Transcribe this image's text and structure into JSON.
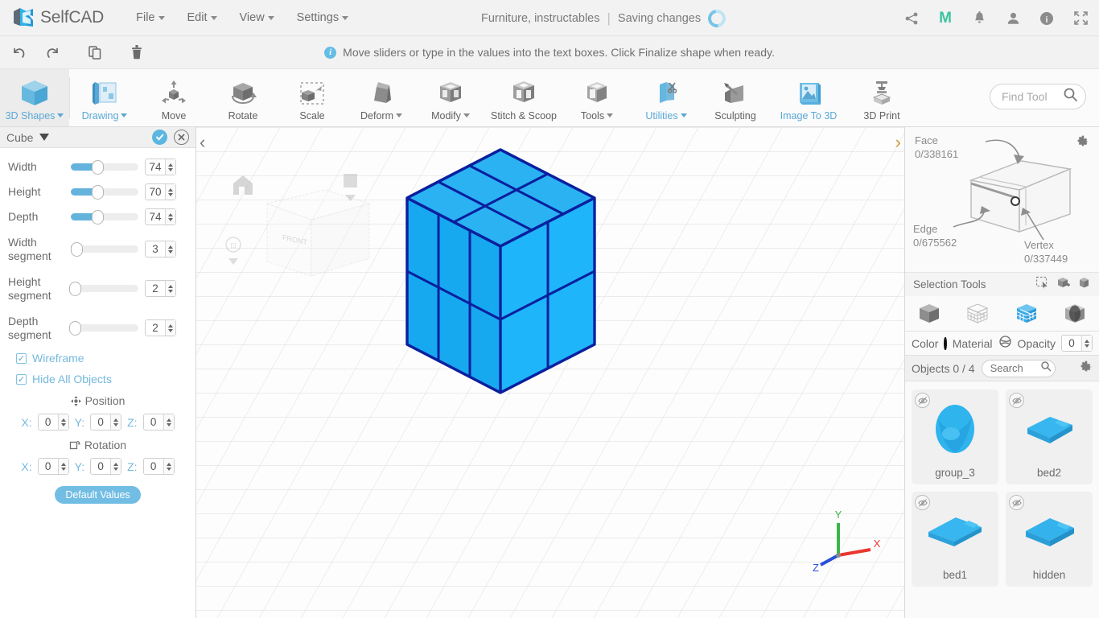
{
  "app": {
    "brand": "SelfCAD",
    "menus": [
      {
        "label": "File",
        "caret": true
      },
      {
        "label": "Edit",
        "caret": true
      },
      {
        "label": "View",
        "caret": true
      },
      {
        "label": "Settings",
        "caret": true
      }
    ],
    "document_title": "Furniture, instructables",
    "separator": "|",
    "save_status": "Saving changes",
    "top_icons": [
      {
        "name": "share-icon"
      },
      {
        "name": "m-brand-icon",
        "label": "M",
        "color": "#3ec3a0"
      },
      {
        "name": "notifications-bell-icon"
      },
      {
        "name": "user-account-icon"
      },
      {
        "name": "info-icon"
      },
      {
        "name": "fullscreen-icon"
      }
    ]
  },
  "strip": {
    "buttons": [
      {
        "name": "undo-button"
      },
      {
        "name": "redo-button"
      },
      {
        "name": "copy-button"
      },
      {
        "name": "delete-button"
      }
    ],
    "message": "Move sliders or type in the values into the text boxes. Click Finalize shape when ready."
  },
  "ribbon": {
    "items": [
      {
        "label": "3D Shapes",
        "caret": true,
        "blue": true,
        "active": true,
        "icon": "cube-icon"
      },
      {
        "label": "Drawing",
        "caret": true,
        "blue": true,
        "icon": "drawing-icon"
      },
      {
        "label": "Move",
        "caret": false,
        "blue": false,
        "icon": "move-icon"
      },
      {
        "label": "Rotate",
        "caret": false,
        "blue": false,
        "icon": "rotate-icon"
      },
      {
        "label": "Scale",
        "caret": false,
        "blue": false,
        "icon": "scale-icon"
      },
      {
        "label": "Deform",
        "caret": true,
        "blue": false,
        "icon": "deform-icon"
      },
      {
        "label": "Modify",
        "caret": true,
        "blue": false,
        "icon": "modify-icon"
      },
      {
        "label": "Stitch & Scoop",
        "caret": false,
        "blue": false,
        "icon": "stitch-scoop-icon"
      },
      {
        "label": "Tools",
        "caret": true,
        "blue": false,
        "icon": "tools-icon"
      },
      {
        "label": "Utilities",
        "caret": true,
        "blue": true,
        "icon": "utilities-icon"
      },
      {
        "label": "Sculpting",
        "caret": false,
        "blue": false,
        "icon": "sculpting-icon"
      },
      {
        "label": "Image To 3D",
        "caret": false,
        "blue": true,
        "icon": "image-to-3d-icon"
      },
      {
        "label": "3D Print",
        "caret": false,
        "blue": false,
        "icon": "3d-print-icon"
      }
    ],
    "find_tool_placeholder": "Find Tool",
    "find_tool_value": ""
  },
  "left_panel": {
    "title": "Cube",
    "confirm_label": "✓",
    "cancel_label": "✕",
    "sliders": [
      {
        "label": "Width",
        "value": "74",
        "fill_pct": 37
      },
      {
        "label": "Height",
        "value": "70",
        "fill_pct": 37
      },
      {
        "label": "Depth",
        "value": "74",
        "fill_pct": 37
      },
      {
        "label": "Width segment",
        "value": "3",
        "fill_pct": 3
      },
      {
        "label": "Height segment",
        "value": "2",
        "fill_pct": 0
      },
      {
        "label": "Depth segment",
        "value": "2",
        "fill_pct": 0
      }
    ],
    "checkboxes": [
      {
        "label": "Wireframe",
        "checked": true
      },
      {
        "label": "Hide All Objects",
        "checked": true
      }
    ],
    "position": {
      "heading": "Position",
      "axes": [
        {
          "label": "X:",
          "value": "0"
        },
        {
          "label": "Y:",
          "value": "0"
        },
        {
          "label": "Z:",
          "value": "0"
        }
      ]
    },
    "rotation": {
      "heading": "Rotation",
      "axes": [
        {
          "label": "X:",
          "value": "0"
        },
        {
          "label": "Y:",
          "value": "0"
        },
        {
          "label": "Z:",
          "value": "0"
        }
      ]
    },
    "default_values_label": "Default Values"
  },
  "viewport": {
    "collapse_left_label": "‹",
    "collapse_right_label": "›",
    "navcube_face_label": "FRONT",
    "axis_labels": {
      "x": "X",
      "y": "Y",
      "z": "Z"
    },
    "axis_colors": {
      "x": "#e8382f",
      "y": "#3cb54a",
      "z": "#2b4fd6"
    },
    "shape": {
      "name": "cube",
      "fill_color": "#19a3ee",
      "top_color": "#22b0f5",
      "side_color": "#10a8f4",
      "edge_color": "#0a1f9e",
      "width_segments": 3,
      "height_segments": 2,
      "depth_segments": 2
    }
  },
  "right_panel": {
    "counters": [
      {
        "label": "Face",
        "value": "0/338161"
      },
      {
        "label": "Edge",
        "value": "0/675562"
      },
      {
        "label": "Vertex",
        "value": "0/337449"
      }
    ],
    "selection_tools_label": "Selection Tools",
    "selection_tool_icons": [
      {
        "name": "rect-select-icon"
      },
      {
        "name": "box-add-select-icon"
      },
      {
        "name": "box-select-icon"
      }
    ],
    "modes": [
      {
        "name": "object-mode-icon",
        "active": false
      },
      {
        "name": "wireframe-mode-icon",
        "active": false
      },
      {
        "name": "face-mode-icon",
        "active": true
      },
      {
        "name": "vertex-mode-icon",
        "active": false
      }
    ],
    "color_label": "Color",
    "color_value": "#111111",
    "material_label": "Material",
    "opacity_label": "Opacity",
    "opacity_value": "0",
    "objects_label": "Objects 0 / 4",
    "search_placeholder": "Search",
    "search_value": "",
    "objects": [
      {
        "name": "group_3",
        "thumb": "blob-thumb"
      },
      {
        "name": "bed2",
        "thumb": "bed-thumb"
      },
      {
        "name": "bed1",
        "thumb": "bed-thumb"
      },
      {
        "name": "hidden",
        "thumb": "bed-thumb"
      }
    ]
  }
}
